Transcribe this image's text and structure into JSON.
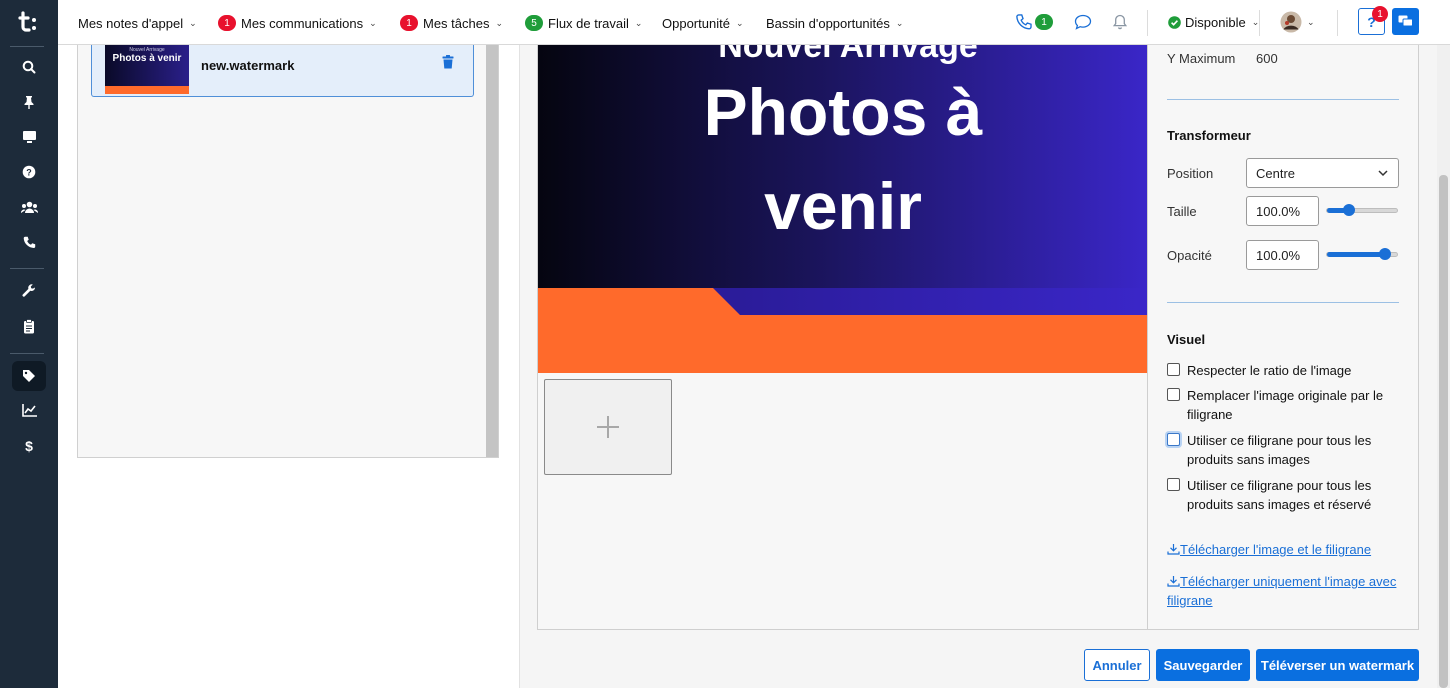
{
  "topbar": {
    "menus": [
      {
        "label": "Mes notes d'appel",
        "badge": null
      },
      {
        "label": "Mes communications",
        "badge": "1",
        "badge_color": "#e8112d"
      },
      {
        "label": "Mes tâches",
        "badge": "1",
        "badge_color": "#e8112d"
      },
      {
        "label": "Flux de travail",
        "badge": "5",
        "badge_color": "#1f9d3a"
      },
      {
        "label": "Opportunité",
        "badge": null
      },
      {
        "label": "Bassin d'opportunités",
        "badge": null
      }
    ],
    "phone_badge": "1",
    "status": "Disponible",
    "help_badge": "1"
  },
  "sidebar": {
    "icons": [
      "search-icon",
      "pin-icon",
      "monitor-icon",
      "help-icon",
      "users-icon",
      "phone-icon",
      "wrench-icon",
      "clipboard-icon",
      "tag-icon",
      "chart-icon",
      "dollar-icon"
    ]
  },
  "watermark_list": {
    "items": [
      {
        "name": "new.watermark",
        "thumb_small": "Nouvel Arrivage",
        "thumb_title": "Photos à venir"
      }
    ]
  },
  "preview": {
    "cut_text": "Nouvel Arrivage",
    "line1": "Photos à",
    "line2": "venir"
  },
  "settings": {
    "y_max_label": "Y Maximum",
    "y_max_value": "600",
    "transformer_heading": "Transformeur",
    "position_label": "Position",
    "position_value": "Centre",
    "size_label": "Taille",
    "size_value": "100.0%",
    "size_level": 0.3,
    "opacity_label": "Opacité",
    "opacity_value": "100.0%",
    "opacity_level": 0.8,
    "visual_heading": "Visuel",
    "checkboxes": [
      {
        "label": "Respecter le ratio de l'image",
        "checked": false
      },
      {
        "label": "Remplacer l'image originale par le filigrane",
        "checked": false
      },
      {
        "label": "Utiliser ce filigrane pour tous les produits sans images",
        "checked": false
      },
      {
        "label": "Utiliser ce filigrane pour tous les produits sans images et réservé",
        "checked": false
      }
    ],
    "download_both": "Télécharger l'image et le filigrane",
    "download_watermarked": "Télécharger uniquement l'image avec filigrane"
  },
  "buttons": {
    "cancel": "Annuler",
    "save": "Sauvegarder",
    "upload": "Téléverser un watermark"
  },
  "colors": {
    "accent": "#0a6fe0",
    "sidebar": "#1d2b3a",
    "badge_red": "#e8112d",
    "badge_green": "#1f9d3a",
    "banner_orange": "#ff6a2b"
  }
}
